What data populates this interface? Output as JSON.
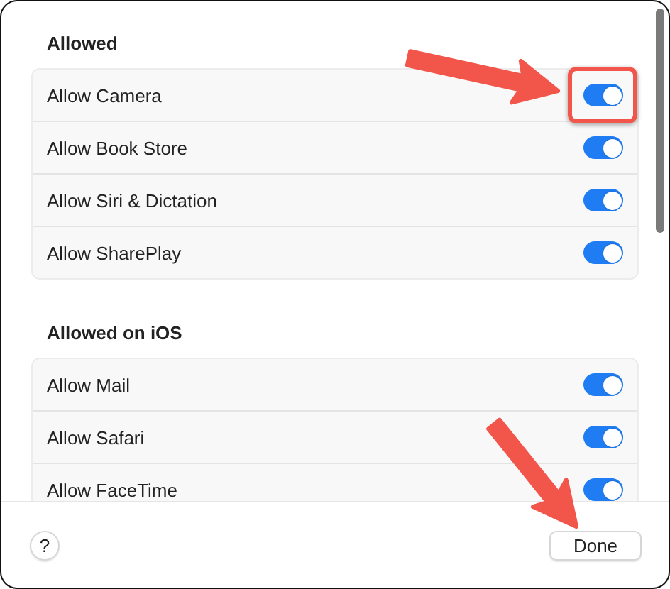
{
  "sections": [
    {
      "title": "Allowed",
      "items": [
        {
          "label": "Allow Camera",
          "on": true,
          "highlighted": true
        },
        {
          "label": "Allow Book Store",
          "on": true,
          "highlighted": false
        },
        {
          "label": "Allow Siri & Dictation",
          "on": true,
          "highlighted": false
        },
        {
          "label": "Allow SharePlay",
          "on": true,
          "highlighted": false
        }
      ]
    },
    {
      "title": "Allowed on iOS",
      "items": [
        {
          "label": "Allow Mail",
          "on": true,
          "highlighted": false
        },
        {
          "label": "Allow Safari",
          "on": true,
          "highlighted": false
        },
        {
          "label": "Allow FaceTime",
          "on": true,
          "highlighted": false
        }
      ]
    }
  ],
  "footer": {
    "help": "?",
    "done": "Done"
  }
}
